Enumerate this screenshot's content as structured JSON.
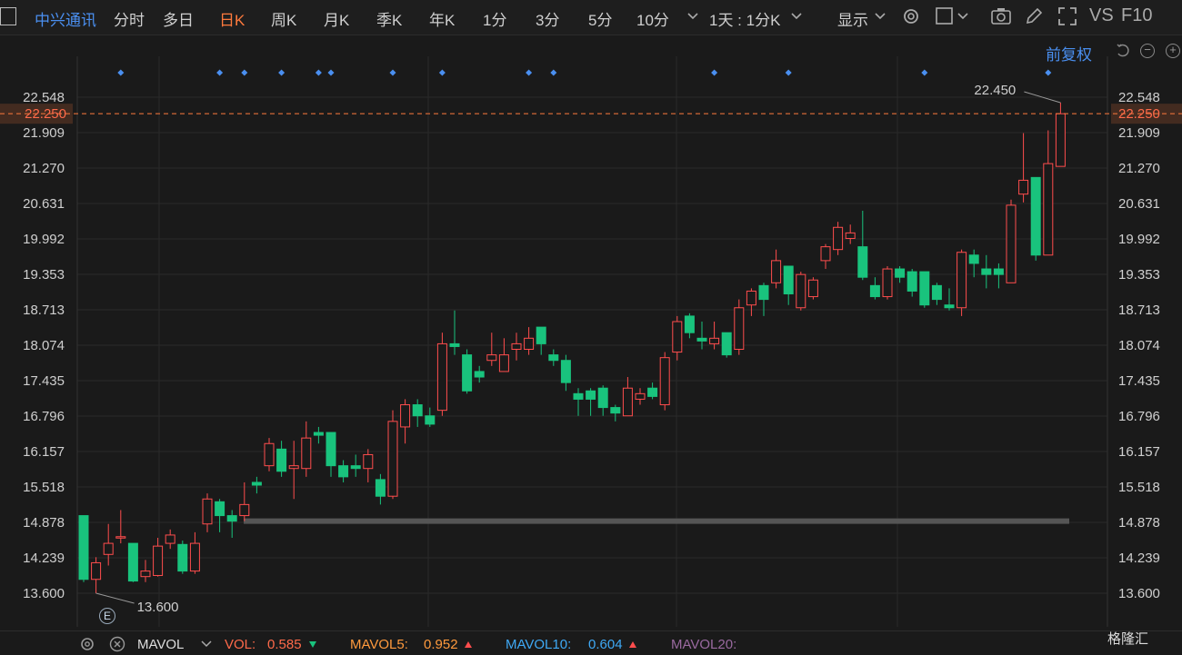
{
  "toolbar": {
    "stock_name": "中兴通讯",
    "tabs": [
      "分时",
      "多日",
      "日K",
      "周K",
      "月K",
      "季K",
      "年K",
      "1分",
      "3分",
      "5分",
      "10分"
    ],
    "active_tab": "日K",
    "period_select": "1天 : 1分K",
    "display_label": "显示",
    "vs_label": "VS",
    "f10_label": "F10"
  },
  "fuquan_label": "前复权",
  "footer": {
    "indicator": "MAVOL",
    "vol_label": "VOL:",
    "vol_value": "0.585",
    "mavol5_label": "MAVOL5:",
    "mavol5_value": "0.952",
    "mavol10_label": "MAVOL10:",
    "mavol10_value": "0.604",
    "mavol20_label": "MAVOL20:"
  },
  "watermark": "格隆汇",
  "e_badge": "E",
  "colors": {
    "up": "#ff4d4d",
    "down": "#19c37d",
    "accent": "#ff7a3d",
    "blue": "#4a8ff0",
    "bg": "#1a1a1a"
  },
  "chart_data": {
    "type": "candlestick",
    "y_ticks": [
      "22.548",
      "21.909",
      "21.270",
      "20.631",
      "19.992",
      "19.353",
      "18.713",
      "18.074",
      "17.435",
      "16.796",
      "16.157",
      "15.518",
      "14.878",
      "14.239",
      "13.600"
    ],
    "ylim": [
      13.6,
      22.548
    ],
    "current_price": "22.250",
    "high_label": "22.450",
    "low_label": "13.600",
    "support_level": 14.9,
    "candles": [
      [
        15.0,
        13.85,
        15.0,
        13.8
      ],
      [
        13.85,
        14.15,
        14.25,
        13.6
      ],
      [
        14.3,
        14.5,
        14.85,
        14.1
      ],
      [
        14.6,
        14.62,
        15.1,
        14.5
      ],
      [
        14.5,
        13.82,
        14.5,
        13.8
      ],
      [
        13.9,
        14.0,
        14.2,
        13.8
      ],
      [
        13.92,
        14.45,
        14.6,
        13.9
      ],
      [
        14.5,
        14.65,
        14.75,
        14.4
      ],
      [
        14.48,
        14.0,
        14.55,
        13.95
      ],
      [
        14.0,
        14.5,
        14.7,
        13.95
      ],
      [
        14.85,
        15.3,
        15.4,
        14.7
      ],
      [
        15.25,
        15.0,
        15.3,
        14.7
      ],
      [
        15.0,
        14.9,
        15.1,
        14.6
      ],
      [
        15.0,
        15.2,
        15.6,
        14.9
      ],
      [
        15.6,
        15.55,
        15.7,
        15.4
      ],
      [
        15.9,
        16.3,
        16.4,
        15.8
      ],
      [
        16.2,
        15.8,
        16.35,
        15.7
      ],
      [
        15.85,
        15.9,
        16.35,
        15.3
      ],
      [
        15.85,
        16.4,
        16.7,
        15.7
      ],
      [
        16.5,
        16.45,
        16.6,
        16.3
      ],
      [
        16.5,
        15.9,
        16.5,
        15.7
      ],
      [
        15.9,
        15.7,
        16.0,
        15.6
      ],
      [
        15.9,
        15.85,
        16.1,
        15.7
      ],
      [
        15.85,
        16.1,
        16.2,
        15.6
      ],
      [
        15.65,
        15.35,
        15.75,
        15.2
      ],
      [
        15.35,
        16.7,
        16.9,
        15.3
      ],
      [
        16.6,
        17.0,
        17.1,
        16.3
      ],
      [
        17.0,
        16.8,
        17.1,
        16.6
      ],
      [
        16.8,
        16.65,
        16.95,
        16.6
      ],
      [
        16.9,
        18.1,
        18.3,
        16.8
      ],
      [
        18.1,
        18.05,
        18.7,
        17.9
      ],
      [
        17.9,
        17.25,
        18.0,
        17.2
      ],
      [
        17.6,
        17.5,
        17.7,
        17.4
      ],
      [
        17.8,
        17.9,
        18.3,
        17.7
      ],
      [
        17.6,
        17.9,
        18.2,
        17.6
      ],
      [
        18.0,
        18.1,
        18.3,
        17.8
      ],
      [
        18.0,
        18.2,
        18.4,
        17.9
      ],
      [
        18.4,
        18.1,
        18.4,
        17.9
      ],
      [
        17.9,
        17.8,
        18.0,
        17.7
      ],
      [
        17.8,
        17.4,
        17.9,
        17.25
      ],
      [
        17.2,
        17.1,
        17.3,
        16.8
      ],
      [
        17.25,
        17.1,
        17.3,
        16.8
      ],
      [
        17.3,
        16.95,
        17.35,
        16.8
      ],
      [
        16.95,
        16.85,
        17.0,
        16.7
      ],
      [
        16.8,
        17.3,
        17.5,
        16.8
      ],
      [
        17.1,
        17.2,
        17.3,
        17.0
      ],
      [
        17.3,
        17.15,
        17.4,
        17.1
      ],
      [
        17.0,
        17.85,
        17.95,
        16.9
      ],
      [
        17.95,
        18.5,
        18.6,
        17.8
      ],
      [
        18.6,
        18.3,
        18.65,
        18.2
      ],
      [
        18.2,
        18.15,
        18.5,
        18.0
      ],
      [
        18.1,
        18.2,
        18.5,
        18.0
      ],
      [
        18.3,
        17.9,
        18.3,
        17.85
      ],
      [
        18.0,
        18.75,
        18.9,
        17.9
      ],
      [
        18.8,
        19.05,
        19.1,
        18.6
      ],
      [
        19.15,
        18.9,
        19.2,
        18.6
      ],
      [
        19.2,
        19.6,
        19.8,
        19.1
      ],
      [
        19.5,
        19.0,
        19.5,
        18.8
      ],
      [
        18.75,
        19.35,
        19.4,
        18.7
      ],
      [
        18.95,
        19.25,
        19.3,
        18.9
      ],
      [
        19.6,
        19.85,
        19.9,
        19.45
      ],
      [
        19.8,
        20.2,
        20.3,
        19.7
      ],
      [
        20.0,
        20.1,
        20.25,
        19.9
      ],
      [
        19.85,
        19.3,
        20.5,
        19.25
      ],
      [
        19.15,
        18.95,
        19.3,
        18.9
      ],
      [
        18.95,
        19.45,
        19.5,
        18.9
      ],
      [
        19.45,
        19.3,
        19.5,
        19.2
      ],
      [
        19.4,
        19.05,
        19.45,
        18.95
      ],
      [
        19.4,
        18.8,
        19.4,
        18.75
      ],
      [
        19.15,
        18.9,
        19.2,
        18.8
      ],
      [
        18.8,
        18.75,
        19.1,
        18.7
      ],
      [
        18.75,
        19.75,
        19.8,
        18.6
      ],
      [
        19.7,
        19.55,
        19.8,
        19.3
      ],
      [
        19.45,
        19.35,
        19.7,
        19.1
      ],
      [
        19.45,
        19.35,
        19.55,
        19.1
      ],
      [
        19.2,
        20.6,
        20.7,
        19.2
      ],
      [
        20.8,
        21.05,
        21.9,
        20.65
      ],
      [
        21.1,
        19.7,
        21.1,
        19.6
      ],
      [
        19.7,
        21.35,
        21.95,
        19.7
      ],
      [
        21.3,
        22.25,
        22.45,
        21.3
      ]
    ],
    "markers": [
      3,
      11,
      13,
      16,
      19,
      20,
      25,
      29,
      36,
      38,
      51,
      57,
      68,
      78
    ]
  }
}
